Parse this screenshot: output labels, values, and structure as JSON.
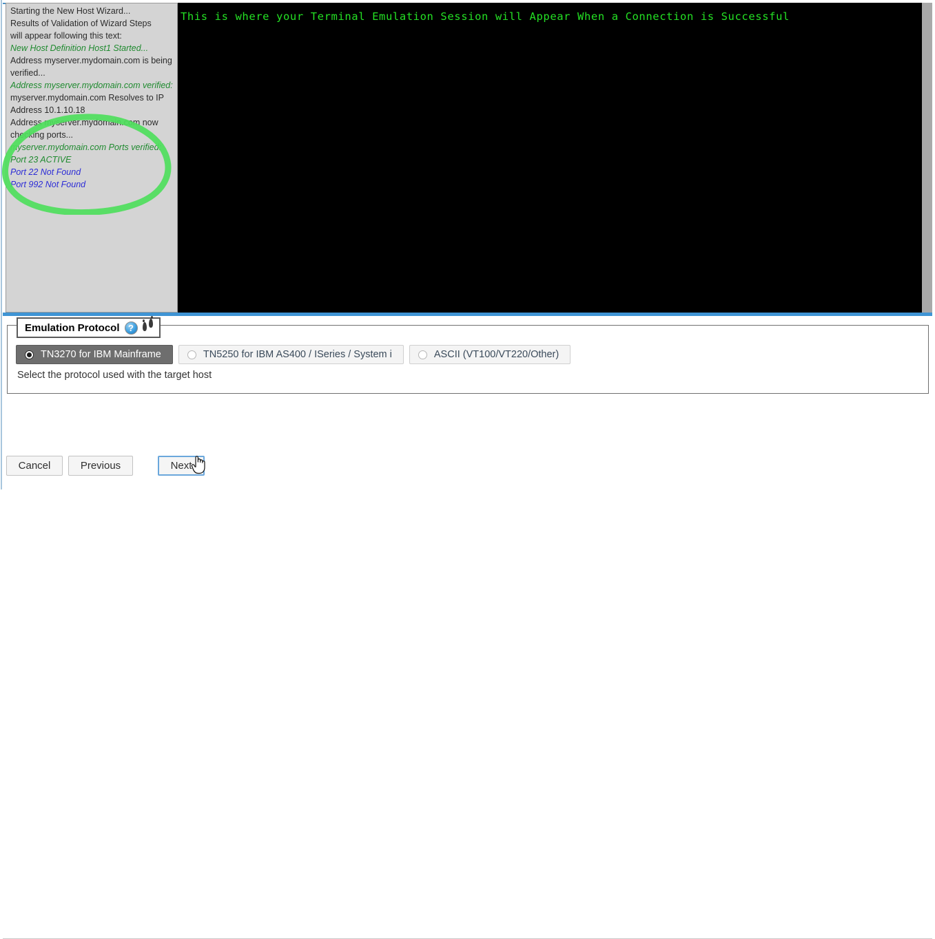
{
  "window": {
    "accent_blue": "#3f94d4",
    "log_background": "#d4d4d4",
    "terminal_background": "#000000",
    "terminal_text_color": "#24e024"
  },
  "log_pane": {
    "name": "validation-log",
    "lines": [
      {
        "text": "Starting the New Host Wizard...",
        "style": "plain"
      },
      {
        "text": "Results of Validation of Wizard Steps",
        "style": "plain"
      },
      {
        "text": "will appear following this text:",
        "style": "plain"
      },
      {
        "text": "New Host Definition Host1 Started...",
        "style": "status-green"
      },
      {
        "text": "Address myserver.mydomain.com is being",
        "style": "plain"
      },
      {
        "text": "verified...",
        "style": "plain"
      },
      {
        "text": "Address myserver.mydomain.com verified:",
        "style": "status-green"
      },
      {
        "text": "myserver.mydomain.com Resolves to IP",
        "style": "plain"
      },
      {
        "text": "Address 10.1.10.18",
        "style": "plain"
      },
      {
        "text": "Address myserver.mydomain.com now",
        "style": "plain"
      },
      {
        "text": "checking ports...",
        "style": "plain"
      },
      {
        "text": "myserver.mydomain.com Ports verified:",
        "style": "status-green"
      },
      {
        "text": "Port 23 ACTIVE",
        "style": "status-green"
      },
      {
        "text": "Port 22 Not Found",
        "style": "status-blue"
      },
      {
        "text": "Port 992 Not Found",
        "style": "status-blue"
      }
    ]
  },
  "annotation": {
    "shape": "ellipse",
    "color": "#4ede5c",
    "encircles": "port verification results"
  },
  "terminal": {
    "text": "This is where your Terminal Emulation Session will Appear When a Connection is Successful"
  },
  "protocol_group": {
    "legend": "Emulation Protocol",
    "help_icon": "help-circle-icon",
    "footprints_icon": "footprints-icon",
    "hint": "Select the protocol used with the target host",
    "options": [
      {
        "label": "TN3270 for IBM Mainframe",
        "selected": true
      },
      {
        "label": "TN5250 for IBM AS400 / ISeries / System i",
        "selected": false
      },
      {
        "label": "ASCII (VT100/VT220/Other)",
        "selected": false
      }
    ]
  },
  "footer": {
    "cancel_label": "Cancel",
    "previous_label": "Previous",
    "next_label": "Next"
  }
}
